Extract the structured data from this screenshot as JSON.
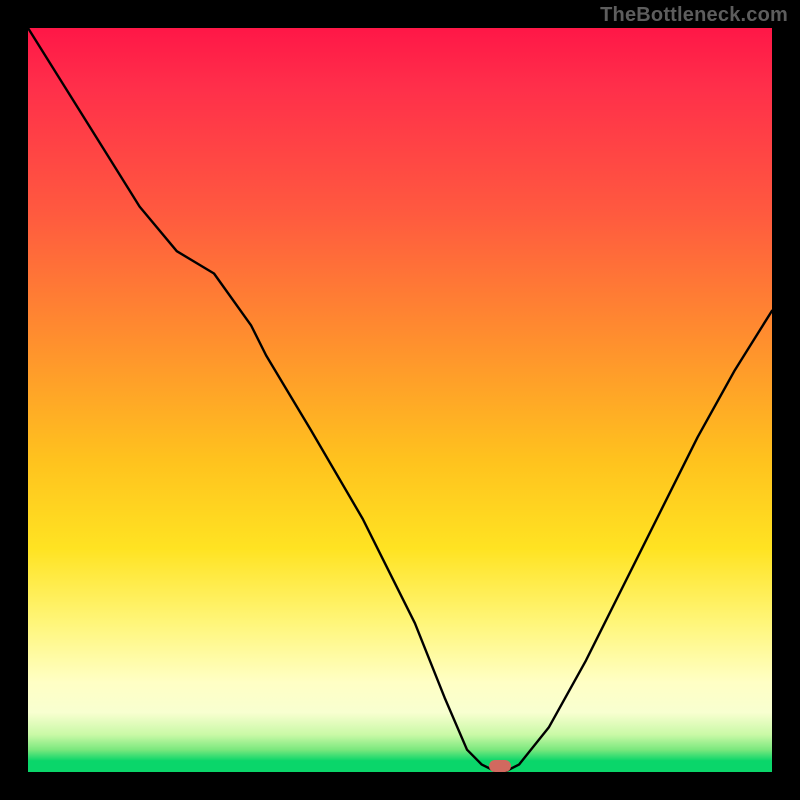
{
  "watermark": "TheBottleneck.com",
  "chart_data": {
    "type": "line",
    "title": "",
    "xlabel": "",
    "ylabel": "",
    "xlim": [
      0,
      100
    ],
    "ylim": [
      0,
      100
    ],
    "grid": false,
    "series": [
      {
        "name": "bottleneck-curve",
        "x": [
          0,
          5,
          10,
          15,
          20,
          25,
          30,
          32,
          38,
          45,
          52,
          56,
          59,
          61,
          63,
          64,
          66,
          70,
          75,
          80,
          85,
          90,
          95,
          100
        ],
        "y": [
          100,
          92,
          84,
          76,
          70,
          67,
          60,
          56,
          46,
          34,
          20,
          10,
          3,
          1,
          0,
          0,
          1,
          6,
          15,
          25,
          35,
          45,
          54,
          62
        ]
      }
    ],
    "marker": {
      "x": 63.5,
      "y": 0.8
    },
    "background_gradient": {
      "direction": "vertical",
      "stops": [
        {
          "pos": 0.0,
          "color": "#ff1747"
        },
        {
          "pos": 0.25,
          "color": "#ff5a3f"
        },
        {
          "pos": 0.58,
          "color": "#ffc21e"
        },
        {
          "pos": 0.8,
          "color": "#fff67a"
        },
        {
          "pos": 0.95,
          "color": "#c9f9a6"
        },
        {
          "pos": 1.0,
          "color": "#0ad66a"
        }
      ]
    }
  }
}
